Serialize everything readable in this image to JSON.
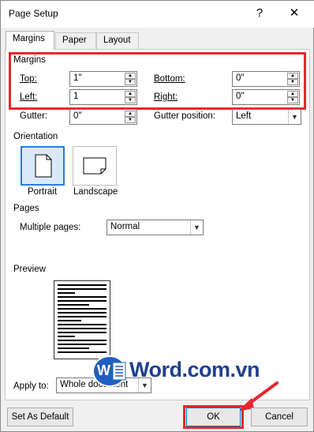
{
  "dialog": {
    "title": "Page Setup",
    "help_glyph": "?",
    "close_glyph": "✕"
  },
  "tabs": [
    {
      "label": "Margins",
      "active": true
    },
    {
      "label": "Paper",
      "active": false
    },
    {
      "label": "Layout",
      "active": false
    }
  ],
  "margins": {
    "group_label": "Margins",
    "top_label": "Top:",
    "top_value": "1\"",
    "bottom_label": "Bottom:",
    "bottom_value": "0\"",
    "left_label": "Left:",
    "left_value": "1",
    "right_label": "Right:",
    "right_value": "0\"",
    "gutter_label": "Gutter:",
    "gutter_value": "0\"",
    "gutter_position_label": "Gutter position:",
    "gutter_position_value": "Left"
  },
  "orientation": {
    "group_label": "Orientation",
    "portrait_label": "Portrait",
    "landscape_label": "Landscape"
  },
  "pages": {
    "group_label": "Pages",
    "multiple_pages_label": "Multiple pages:",
    "multiple_pages_value": "Normal"
  },
  "preview": {
    "group_label": "Preview"
  },
  "apply_to": {
    "label": "Apply to:",
    "value": "Whole document"
  },
  "buttons": {
    "set_as_default": "Set As Default",
    "ok": "OK",
    "cancel": "Cancel"
  },
  "watermark": {
    "text": "Word.com.vn",
    "logo_letter": "W"
  },
  "colors": {
    "highlight": "#e8262e",
    "selection": "#2b7bd5",
    "watermark": "#1f3f8f"
  }
}
